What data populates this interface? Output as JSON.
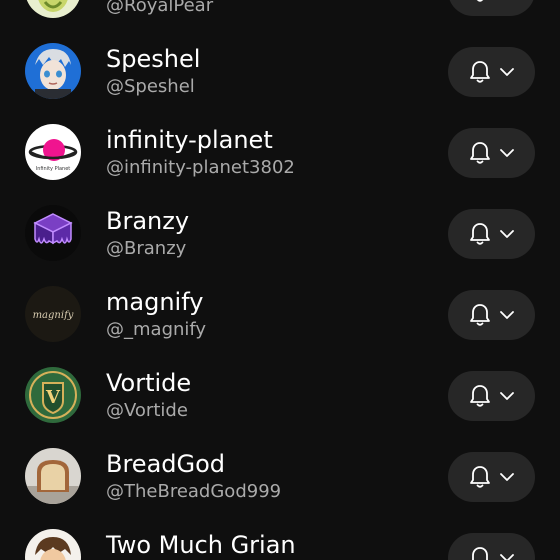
{
  "subscriptions": [
    {
      "name": "",
      "handle": "@RoyalPear",
      "avatar": "royalpear-avatar"
    },
    {
      "name": "Speshel",
      "handle": "@Speshel",
      "avatar": "speshel-avatar"
    },
    {
      "name": "infinity-planet",
      "handle": "@infinity-planet3802",
      "avatar": "infinity-planet-avatar"
    },
    {
      "name": "Branzy",
      "handle": "@Branzy",
      "avatar": "branzy-avatar"
    },
    {
      "name": "magnify",
      "handle": "@_magnify",
      "avatar": "magnify-avatar"
    },
    {
      "name": "Vortide",
      "handle": "@Vortide",
      "avatar": "vortide-avatar"
    },
    {
      "name": "BreadGod",
      "handle": "@TheBreadGod999",
      "avatar": "breadgod-avatar"
    },
    {
      "name": "Two Much Grian",
      "handle": "",
      "avatar": "two-much-grian-avatar"
    }
  ],
  "avatar_art": {
    "infinity_planet_text": "Infinity Planet",
    "magnify_text": "magnify",
    "vortide_letter": "V"
  },
  "notification_button": {
    "icon": "bell-icon",
    "dropdown_icon": "chevron-down-icon"
  },
  "colors": {
    "background": "#0f0f0f",
    "button_bg": "#272727",
    "primary_text": "#ffffff",
    "secondary_text": "#aaaaaa"
  }
}
